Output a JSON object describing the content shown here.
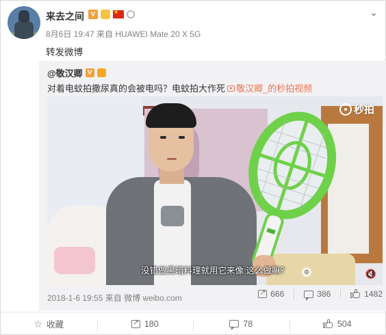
{
  "post": {
    "author": "来去之间",
    "meta": "8月6日 19:47 来自 HUAWEI Mate 20 X 5G",
    "text": "转发微博"
  },
  "original": {
    "author": "@敬汉卿",
    "text": "对着电蚊拍撒尿真的会被电吗？电蚊拍大作死",
    "link_text": "敬汉卿_的秒拍视频",
    "video": {
      "watermark": "秒拍",
      "subtitle": "没错做黑暗料理就用它来像 这么做嘛？"
    },
    "footer": "2018-1-6 19:55 来自 微博 weibo.com",
    "actions": {
      "forward_count": "666",
      "comment_count": "386",
      "like_count": "1482"
    }
  },
  "bottom_bar": {
    "favorite_label": "收藏",
    "forward_count": "180",
    "comment_count": "78",
    "like_count": "504"
  },
  "icons": {
    "more": "chevron-down-icon",
    "forward": "forward-icon",
    "comment": "comment-icon",
    "like": "like-icon",
    "favorite": "star-icon"
  },
  "colors": {
    "link": "#eb7350",
    "verified_badge": "#f3a03a",
    "racket_green": "#6fd14a"
  }
}
